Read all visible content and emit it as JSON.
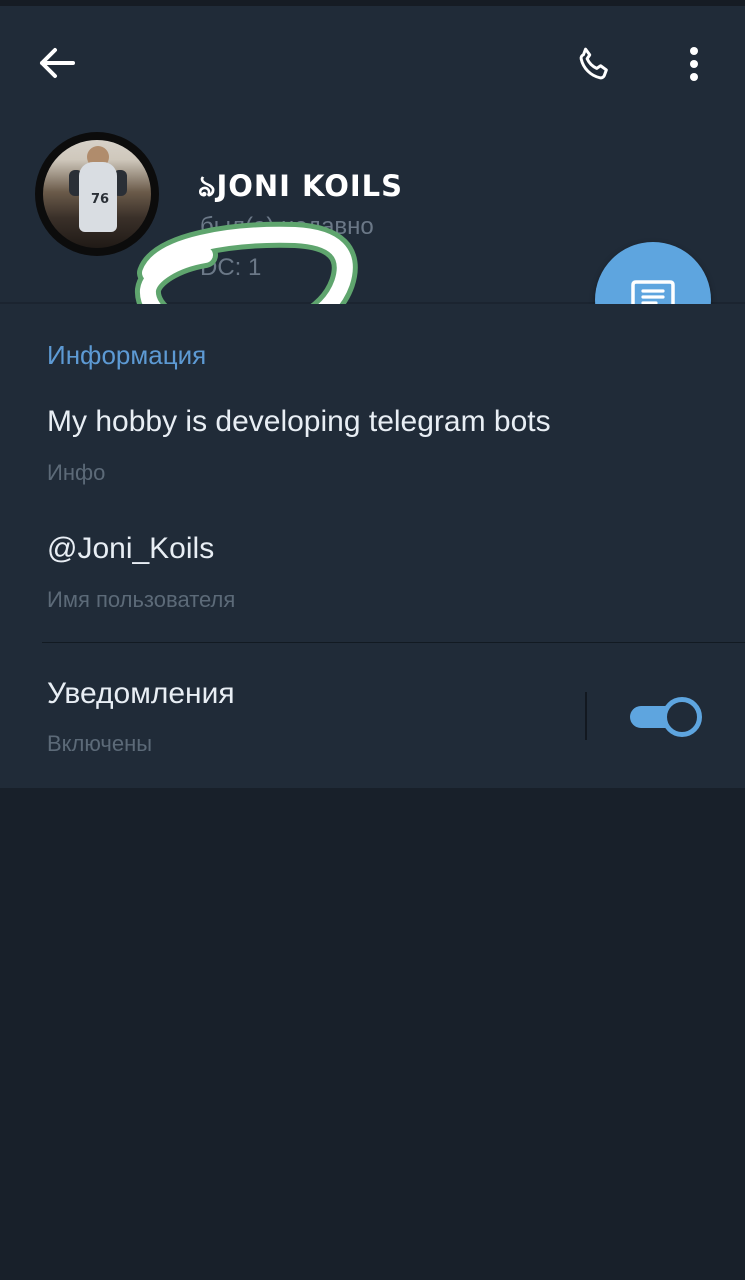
{
  "topbar": {
    "back_icon": "arrow-left-icon",
    "call_icon": "phone-icon",
    "menu_icon": "more-vertical-icon"
  },
  "profile": {
    "name": "ঌJONI KOILS",
    "status": "был(а) недавно",
    "dc": "DC: 1",
    "avatar_number": "76"
  },
  "fab": {
    "icon": "message-icon"
  },
  "info": {
    "section_title": "Информация",
    "bio": {
      "value": "My hobby is developing telegram bots",
      "label": "Инфо"
    },
    "username": {
      "value": "@Joni_Koils",
      "label": "Имя пользователя"
    },
    "notifications": {
      "title": "Уведомления",
      "state": "Включены",
      "enabled": true
    }
  },
  "colors": {
    "header_bg": "#202b38",
    "page_bg": "#18202a",
    "accent": "#5ea5df",
    "section_title": "#5d9ad4",
    "primary_text": "#e8eef4",
    "secondary_text": "#5c6a78",
    "scribble_outline": "#5fa56e",
    "scribble_fill": "#ffffff"
  }
}
